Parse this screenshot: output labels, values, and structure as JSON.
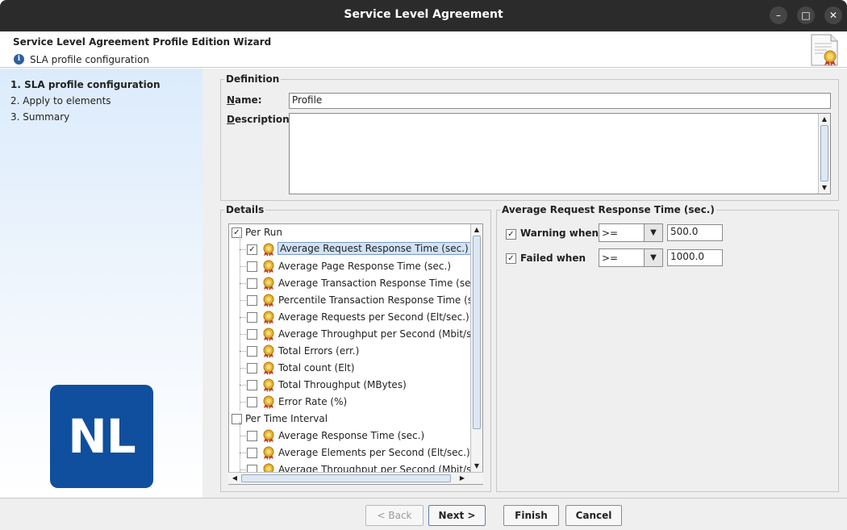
{
  "window": {
    "title": "Service Level Agreement",
    "controls": {
      "minimize": "–",
      "maximize": "□",
      "close": "✕"
    }
  },
  "header": {
    "wizard_title": "Service Level Agreement Profile Edition Wizard",
    "subtitle": "SLA profile configuration",
    "info_glyph": "i"
  },
  "steps": [
    {
      "label": "1. SLA profile configuration",
      "active": true
    },
    {
      "label": "2. Apply to elements",
      "active": false
    },
    {
      "label": "3. Summary",
      "active": false
    }
  ],
  "logo": {
    "text": "NL",
    "color": "#0f4f9e"
  },
  "definition": {
    "legend": "Definition",
    "name_label_mnemonic": "N",
    "name_label_rest": "ame:",
    "name_value": "Profile",
    "description_label_mnemonic": "D",
    "description_label_rest": "escription:",
    "description_value": ""
  },
  "details": {
    "legend": "Details",
    "groups": [
      {
        "label": "Per Run",
        "checked": true,
        "items": [
          {
            "label": "Average Request Response Time (sec.)",
            "checked": true,
            "selected": true
          },
          {
            "label": "Average Page Response Time (sec.)",
            "checked": false
          },
          {
            "label": "Average Transaction Response Time (sec.)",
            "checked": false
          },
          {
            "label": "Percentile Transaction Response Time (sec",
            "checked": false
          },
          {
            "label": "Average Requests per Second (Elt/sec.)",
            "checked": false
          },
          {
            "label": "Average Throughput per Second (Mbit/sec.",
            "checked": false
          },
          {
            "label": "Total Errors (err.)",
            "checked": false
          },
          {
            "label": "Total count (Elt)",
            "checked": false
          },
          {
            "label": "Total Throughput (MBytes)",
            "checked": false
          },
          {
            "label": "Error Rate (%)",
            "checked": false
          }
        ]
      },
      {
        "label": "Per Time Interval",
        "checked": false,
        "items": [
          {
            "label": "Average Response Time (sec.)",
            "checked": false
          },
          {
            "label": "Average Elements per Second (Elt/sec.)",
            "checked": false
          },
          {
            "label": "Average Throughput per Second (Mbit/sec.",
            "checked": false
          }
        ]
      }
    ]
  },
  "thresholds": {
    "legend": "Average Request Response Time (sec.)",
    "warning": {
      "label": "Warning when",
      "checked": true,
      "operator": ">=",
      "value": "500.0"
    },
    "failed": {
      "label": "Failed when",
      "checked": true,
      "operator": ">=",
      "value": "1000.0"
    }
  },
  "footer": {
    "back": "< Back",
    "next": "Next >",
    "finish": "Finish",
    "cancel": "Cancel"
  },
  "colors": {
    "titlebar": "#2b2b2b",
    "selection": "#d2e3f6",
    "logo": "#0f4f9e"
  }
}
